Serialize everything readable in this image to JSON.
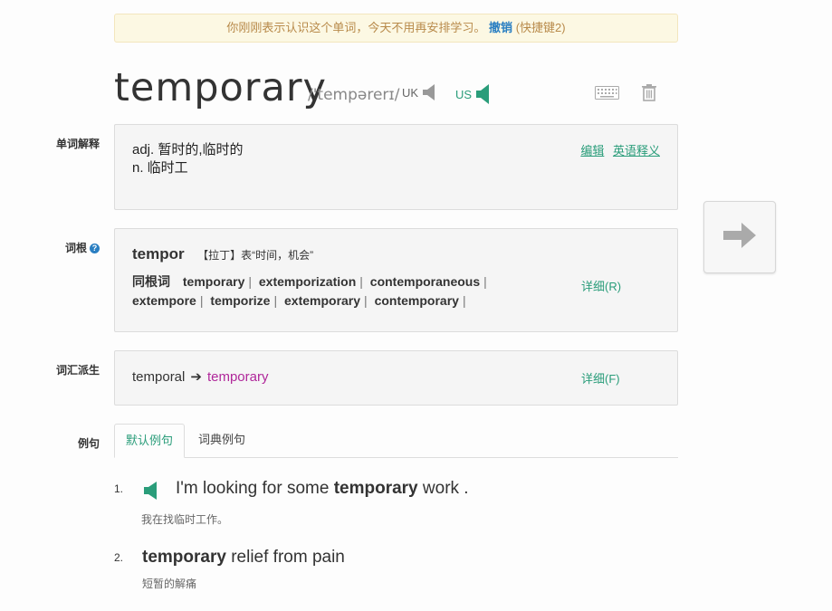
{
  "notice": {
    "text": "你刚刚表示认识这个单词，今天不用再安排学习。",
    "undo_label": "撤销",
    "undo_hint": "(快捷键2)"
  },
  "word": {
    "text": "temporary",
    "phonetic": "/'tempərerɪ/",
    "uk_label": "UK",
    "us_label": "US"
  },
  "definitions": {
    "label": "单词解释",
    "lines": [
      "adj. 暂时的,临时的",
      "n. 临时工"
    ],
    "edit_label": "编辑",
    "english_label": "英语释义"
  },
  "root": {
    "label": "词根",
    "help_icon": "?",
    "word": "tempor",
    "meaning": "【拉丁】表“时间，机会”",
    "cognates_label": "同根词",
    "cognates": [
      "temporary",
      "extemporization",
      "contemporaneous",
      "extempore",
      "temporize",
      "extemporary",
      "contemporary"
    ],
    "detail_label": "详细(R)"
  },
  "derivation": {
    "label": "词汇派生",
    "from": "temporal",
    "arrow": "➔",
    "to": "temporary",
    "detail_label": "详细(F)"
  },
  "examples_section": {
    "label": "例句",
    "tabs": [
      "默认例句",
      "词典例句"
    ]
  },
  "examples": [
    {
      "num": "1.",
      "before": "I'm looking for some ",
      "keyword": "temporary",
      "after": " work .",
      "cn": "我在找临时工作。"
    },
    {
      "num": "2.",
      "before": "",
      "keyword": "temporary",
      "after": " relief from pain",
      "cn": "短暂的解痛"
    }
  ],
  "icons": {
    "speaker": "speaker-icon",
    "keyboard": "keyboard-icon",
    "trash": "trash-icon",
    "next": "arrow-right-icon"
  },
  "colors": {
    "accent_green": "#2a9d7a",
    "link_blue": "#2a7fc2",
    "derived_purple": "#b0279a",
    "notice_bg": "#fcf8e3"
  }
}
